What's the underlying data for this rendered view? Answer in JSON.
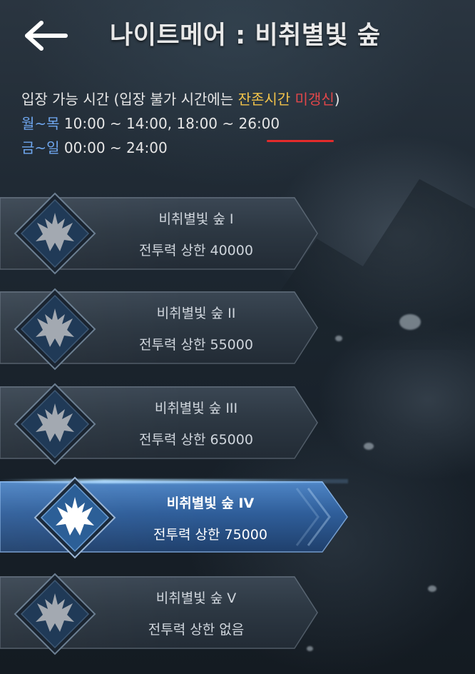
{
  "header": {
    "title": "나이트메어 : 비취별빛 숲",
    "back_icon": "arrow-left-icon"
  },
  "entry_info": {
    "heading_prefix": "입장 가능 시간 (입장 불가 시간에는 ",
    "heading_highlight_1": "잔존시간",
    "heading_space": " ",
    "heading_highlight_2": "미갱신",
    "heading_suffix": ")",
    "weekday_label": "월~목",
    "weekday_times": " 10:00 ~ 14:00, 18:00 ~ 26:00",
    "weekend_label": "금~일",
    "weekend_times": " 00:00 ~ 24:00",
    "colors": {
      "highlight_yellow": "#f1c24a",
      "highlight_red": "#e3474a",
      "day_label_blue": "#6fa7ef",
      "underline_red": "#e42b2b"
    }
  },
  "dungeons": [
    {
      "name": "비취별빛 숲  I",
      "limit": "전투력 상한 40000",
      "selected": false,
      "icon": "dragon-crest-icon"
    },
    {
      "name": "비취별빛 숲  II",
      "limit": "전투력 상한 55000",
      "selected": false,
      "icon": "dragon-crest-icon"
    },
    {
      "name": "비취별빛 숲  III",
      "limit": "전투력 상한 65000",
      "selected": false,
      "icon": "dragon-crest-icon"
    },
    {
      "name": "비취별빛 숲  IV",
      "limit": "전투력 상한 75000",
      "selected": true,
      "icon": "dragon-crest-icon"
    },
    {
      "name": "비취별빛 숲  V",
      "limit": "전투력 상한 없음",
      "selected": false,
      "icon": "dragon-crest-icon"
    }
  ]
}
